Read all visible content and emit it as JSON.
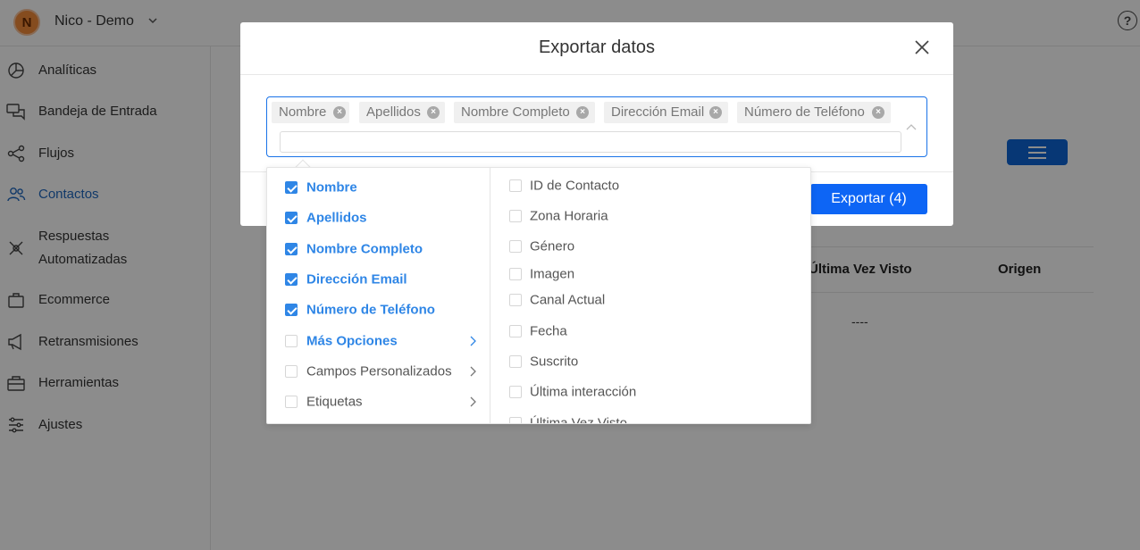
{
  "topbar": {
    "avatar_letter": "N",
    "account_name": "Nico - Demo",
    "avatar_color": "#f28a3a",
    "help_symbol": "?"
  },
  "sidebar": {
    "items": [
      {
        "label": "Analíticas",
        "icon": "pie-chart-icon"
      },
      {
        "label": "Bandeja de Entrada",
        "icon": "chat-bubbles-icon"
      },
      {
        "label": "Flujos",
        "icon": "flow-nodes-icon"
      },
      {
        "label": "Contactos",
        "icon": "users-icon",
        "active": true
      },
      {
        "label": "Respuestas Automatizadas",
        "icon": "robot-icon"
      },
      {
        "label": "Ecommerce",
        "icon": "shopping-bag-icon"
      },
      {
        "label": "Retransmisiones",
        "icon": "megaphone-icon"
      },
      {
        "label": "Herramientas",
        "icon": "toolbox-icon"
      },
      {
        "label": "Ajustes",
        "icon": "sliders-icon"
      }
    ],
    "active_color": "#2068c0"
  },
  "main": {
    "columns": [
      "Última Vez Visto",
      "Origen"
    ],
    "empty_value": "----"
  },
  "modal": {
    "title": "Exportar datos",
    "tags": [
      "Nombre",
      "Apellidos",
      "Nombre Completo",
      "Dirección Email",
      "Número de Teléfono"
    ],
    "search_value": "",
    "export_label": "Exportar (4)",
    "accent_color": "#0d65f5"
  },
  "cascader": {
    "left_options": [
      {
        "label": "Nombre",
        "checked": true
      },
      {
        "label": "Apellidos",
        "checked": true
      },
      {
        "label": "Nombre Completo",
        "checked": true
      },
      {
        "label": "Dirección Email",
        "checked": true
      },
      {
        "label": "Número de Teléfono",
        "checked": true
      },
      {
        "label": "Más Opciones",
        "checked": false,
        "highlight": true
      },
      {
        "label": "Campos Personalizados",
        "checked": false
      },
      {
        "label": "Etiquetas",
        "checked": false
      }
    ],
    "right_options": [
      "ID de Contacto",
      "Zona Horaria",
      "Género",
      "Imagen",
      "Canal Actual",
      "Fecha",
      "Suscrito",
      "Última interacción",
      "Última Vez Visto"
    ],
    "check_color": "#2f86e6"
  }
}
